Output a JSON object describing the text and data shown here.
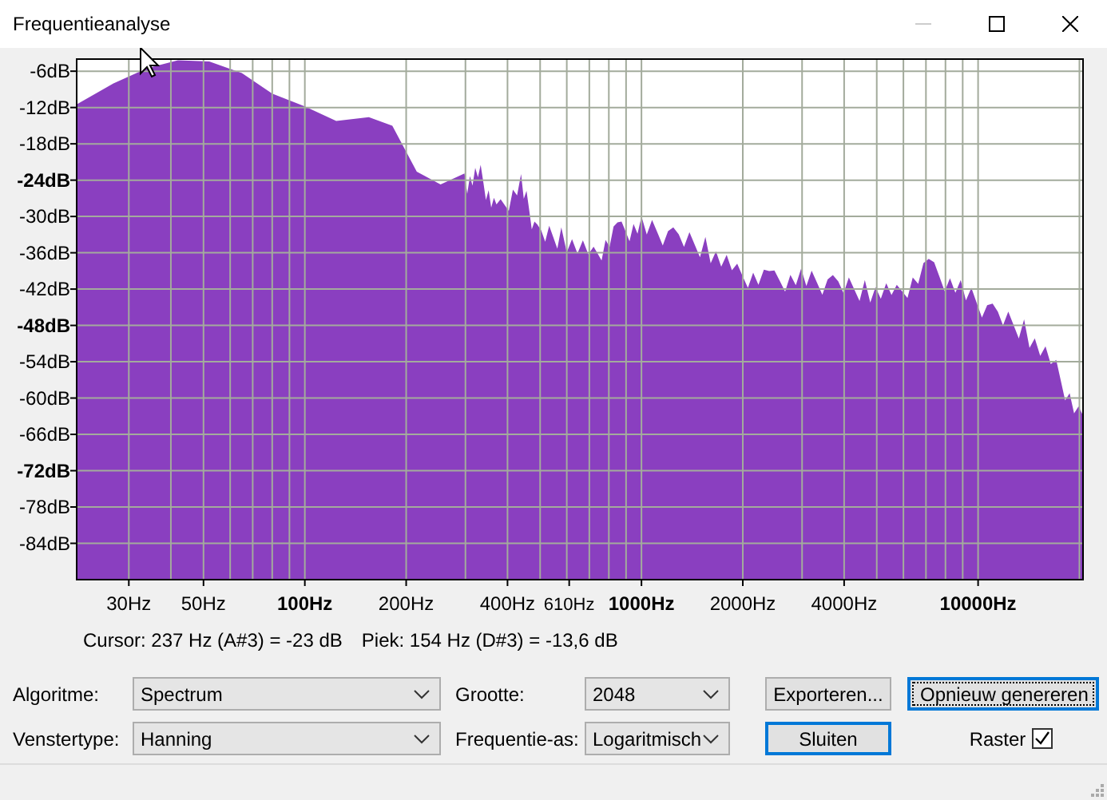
{
  "window": {
    "title": "Frequentieanalyse"
  },
  "spectrum": {
    "y_axis_labels": [
      "-6dB",
      "-12dB",
      "-18dB",
      "-24dB",
      "-30dB",
      "-36dB",
      "-42dB",
      "-48dB",
      "-54dB",
      "-60dB",
      "-66dB",
      "-72dB",
      "-78dB",
      "-84dB"
    ],
    "x_axis_labels": [
      "30Hz",
      "50Hz",
      "100Hz",
      "200Hz",
      "400Hz",
      "610Hz",
      "1000Hz",
      "2000Hz",
      "4000Hz",
      "10000Hz"
    ]
  },
  "cursor_readout": "Cursor: 237 Hz (A#3) = -23 dB",
  "peak_readout": "Piek: 154 Hz (D#3) = -13,6 dB",
  "settings": [
    {
      "label": "Algoritme:",
      "value": "Spectrum"
    },
    {
      "label": "Grootte:",
      "value": "2048"
    },
    {
      "label": "Venstertype:",
      "value": "Hanning"
    },
    {
      "label": "Frequentie-as:",
      "value": "Logaritmisch"
    }
  ],
  "buttons": [
    {
      "label": "Exporteren...",
      "default": false,
      "focused": false
    },
    {
      "label": "Opnieuw genereren",
      "default": false,
      "focused": true
    },
    {
      "label": "Sluiten",
      "default": true,
      "focused": false
    }
  ],
  "grid_option": {
    "label": "Raster",
    "checked": true
  }
}
